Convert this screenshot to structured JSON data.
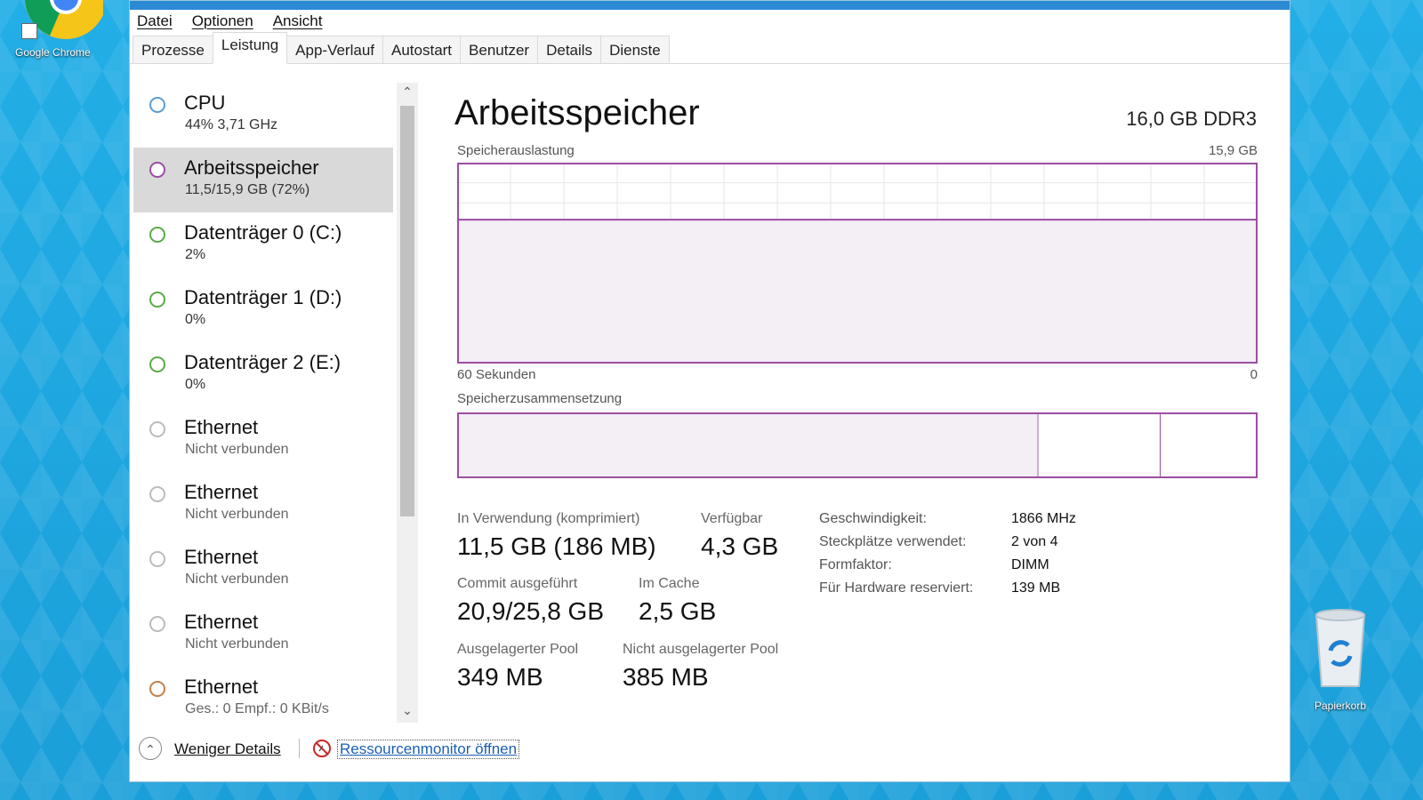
{
  "desktop": {
    "chrome_label": "Google Chrome",
    "recycle_label": "Papierkorb"
  },
  "menu": [
    "Datei",
    "Optionen",
    "Ansicht"
  ],
  "tabs": [
    "Prozesse",
    "Leistung",
    "App-Verlauf",
    "Autostart",
    "Benutzer",
    "Details",
    "Dienste"
  ],
  "active_tab": "Leistung",
  "resources": [
    {
      "name": "CPU",
      "sub": "44%  3,71 GHz",
      "color": "#5b9bd5"
    },
    {
      "name": "Arbeitsspeicher",
      "sub": "11,5/15,9 GB (72%)",
      "color": "#9b4ea3"
    },
    {
      "name": "Datenträger 0 (C:)",
      "sub": "2%",
      "color": "#5aaa46"
    },
    {
      "name": "Datenträger 1 (D:)",
      "sub": "0%",
      "color": "#5aaa46"
    },
    {
      "name": "Datenträger 2 (E:)",
      "sub": "0%",
      "color": "#5aaa46"
    },
    {
      "name": "Ethernet",
      "sub": "Nicht verbunden",
      "color": "#bbbbbb"
    },
    {
      "name": "Ethernet",
      "sub": "Nicht verbunden",
      "color": "#bbbbbb"
    },
    {
      "name": "Ethernet",
      "sub": "Nicht verbunden",
      "color": "#bbbbbb"
    },
    {
      "name": "Ethernet",
      "sub": "Nicht verbunden",
      "color": "#bbbbbb"
    },
    {
      "name": "Ethernet",
      "sub": "Ges.: 0  Empf.: 0 KBit/s",
      "color": "#c0804a"
    }
  ],
  "panel": {
    "title": "Arbeitsspeicher",
    "spec": "16,0 GB DDR3",
    "graph_label": "Speicherauslastung",
    "graph_max": "15,9 GB",
    "graph_time": "60 Sekunden",
    "graph_zero": "0",
    "comp_label": "Speicherzusammensetzung",
    "usage_fraction": 0.72,
    "composition": {
      "in_use": 0.725,
      "standby_end": 0.88
    },
    "stats": {
      "in_use_label": "In Verwendung (komprimiert)",
      "in_use_value": "11,5 GB (186 MB)",
      "available_label": "Verfügbar",
      "available_value": "4,3 GB",
      "commit_label": "Commit ausgeführt",
      "commit_value": "20,9/25,8 GB",
      "cache_label": "Im Cache",
      "cache_value": "2,5 GB",
      "paged_label": "Ausgelagerter Pool",
      "paged_value": "349 MB",
      "nonpaged_label": "Nicht ausgelagerter Pool",
      "nonpaged_value": "385 MB"
    },
    "details": [
      {
        "key": "Geschwindigkeit:",
        "value": "1866 MHz"
      },
      {
        "key": "Steckplätze verwendet:",
        "value": "2 von 4"
      },
      {
        "key": "Formfaktor:",
        "value": "DIMM"
      },
      {
        "key": "Für Hardware reserviert:",
        "value": "139 MB"
      }
    ]
  },
  "footer": {
    "less_details": "Weniger Details",
    "resource_monitor": "Ressourcenmonitor öffnen"
  },
  "colors": {
    "memory": "#9b4ea3",
    "memory_fill": "#f4eef5",
    "accent": "#2b8ad3"
  }
}
